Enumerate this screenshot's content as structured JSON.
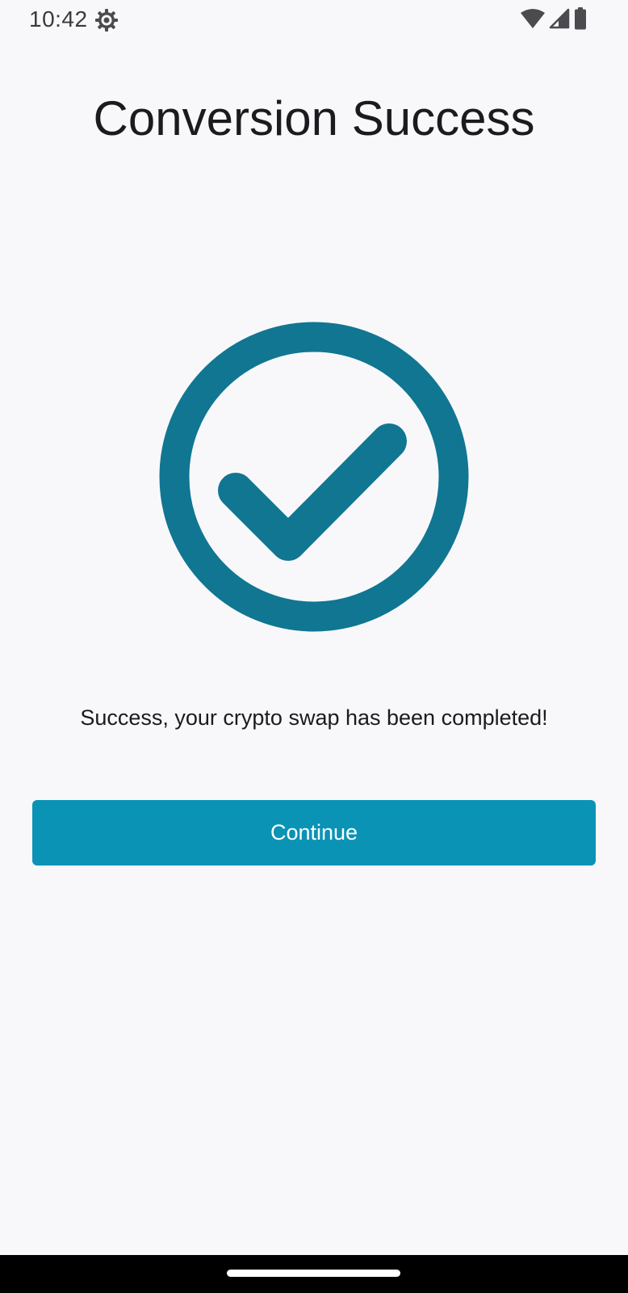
{
  "status_bar": {
    "time": "10:42",
    "icons": [
      "settings-gear-icon",
      "wifi-icon",
      "signal-icon",
      "battery-icon"
    ]
  },
  "screen": {
    "title": "Conversion Success",
    "icon": "check-circle-icon",
    "message": "Success, your crypto swap has been completed!",
    "continue_label": "Continue"
  },
  "colors": {
    "background": "#f8f8fb",
    "check_circle": "#107692",
    "button": "#0a93b5",
    "button_text": "#ffffff",
    "nav_bar": "#000000"
  }
}
